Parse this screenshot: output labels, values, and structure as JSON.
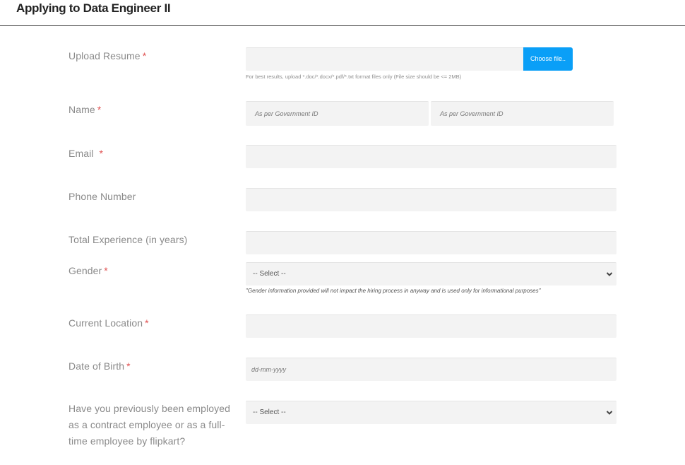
{
  "header": {
    "title": "Applying to Data Engineer II"
  },
  "form": {
    "resume": {
      "label": "Upload Resume",
      "required_mark": "*",
      "button_label": "Choose file..",
      "hint": "For best results, upload *.doc/*.docx/*.pdf/*.txt format files only (File size should be <= 2MB)"
    },
    "name": {
      "label": "Name",
      "required_mark": "*",
      "first_placeholder": "As per Government ID",
      "last_placeholder": "As per Government ID"
    },
    "email": {
      "label": "Email",
      "required_mark": "*",
      "value": ""
    },
    "phone": {
      "label": "Phone Number",
      "value": ""
    },
    "experience": {
      "label": "Total Experience (in years)",
      "value": ""
    },
    "gender": {
      "label": "Gender",
      "required_mark": "*",
      "selected": "-- Select --",
      "note": "\"Gender information provided will not impact the hiring process in anyway and is used only for informational purposes\""
    },
    "location": {
      "label": "Current Location",
      "required_mark": "*",
      "value": ""
    },
    "dob": {
      "label": "Date of Birth",
      "required_mark": "*",
      "placeholder": "dd-mm-yyyy"
    },
    "previous_employment": {
      "label": "Have you previously been employed as a contract employee or as a full-time employee by flipkart?",
      "selected": "-- Select --"
    }
  },
  "colors": {
    "accent": "#0a9ff7",
    "required": "#e05252",
    "field_bg": "#f3f3f3"
  }
}
